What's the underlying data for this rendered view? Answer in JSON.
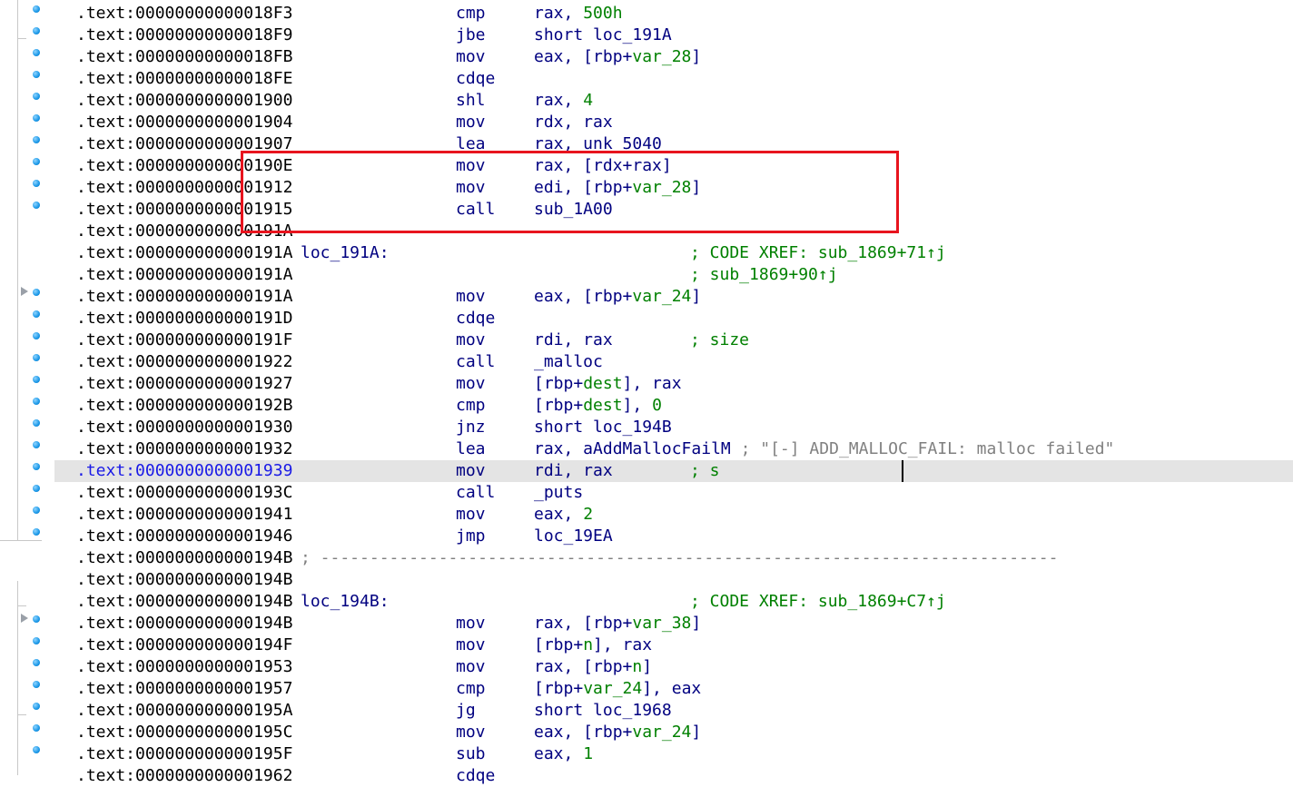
{
  "lines": [
    {
      "addr": ".text:00000000000018F3",
      "label": "",
      "mnem": "cmp",
      "ops": [
        {
          "t": "rax, "
        },
        {
          "t": "500h",
          "c": "num"
        }
      ],
      "cmt": ""
    },
    {
      "addr": ".text:00000000000018F9",
      "label": "",
      "mnem": "jbe",
      "ops": [
        {
          "t": "short loc_191A"
        }
      ],
      "cmt": ""
    },
    {
      "addr": ".text:00000000000018FB",
      "label": "",
      "mnem": "mov",
      "ops": [
        {
          "t": "eax, [rbp+"
        },
        {
          "t": "var_28",
          "c": "var"
        },
        {
          "t": "]"
        }
      ],
      "cmt": ""
    },
    {
      "addr": ".text:00000000000018FE",
      "label": "",
      "mnem": "cdqe",
      "ops": [],
      "cmt": ""
    },
    {
      "addr": ".text:0000000000001900",
      "label": "",
      "mnem": "shl",
      "ops": [
        {
          "t": "rax, "
        },
        {
          "t": "4",
          "c": "num"
        }
      ],
      "cmt": ""
    },
    {
      "addr": ".text:0000000000001904",
      "label": "",
      "mnem": "mov",
      "ops": [
        {
          "t": "rdx, rax"
        }
      ],
      "cmt": ""
    },
    {
      "addr": ".text:0000000000001907",
      "label": "",
      "mnem": "lea",
      "ops": [
        {
          "t": "rax, unk_5040"
        }
      ],
      "cmt": ""
    },
    {
      "addr": ".text:000000000000190E",
      "label": "",
      "mnem": "mov",
      "ops": [
        {
          "t": "rax, [rdx+rax]"
        }
      ],
      "cmt": ""
    },
    {
      "addr": ".text:0000000000001912",
      "label": "",
      "mnem": "mov",
      "ops": [
        {
          "t": "edi, [rbp+"
        },
        {
          "t": "var_28",
          "c": "var"
        },
        {
          "t": "]"
        }
      ],
      "cmt": ""
    },
    {
      "addr": ".text:0000000000001915",
      "label": "",
      "mnem": "call",
      "ops": [
        {
          "t": "sub_1A00"
        }
      ],
      "cmt": ""
    },
    {
      "addr": ".text:000000000000191A",
      "label": "",
      "mnem": "",
      "ops": [],
      "cmt": ""
    },
    {
      "addr": ".text:000000000000191A",
      "label": "loc_191A:",
      "mnem": "",
      "ops": [],
      "cmt": "; CODE XREF: sub_1869+71↑j"
    },
    {
      "addr": ".text:000000000000191A",
      "label": "",
      "mnem": "",
      "ops": [],
      "cmt": "; sub_1869+90↑j"
    },
    {
      "addr": ".text:000000000000191A",
      "label": "",
      "mnem": "mov",
      "ops": [
        {
          "t": "eax, [rbp+"
        },
        {
          "t": "var_24",
          "c": "var"
        },
        {
          "t": "]"
        }
      ],
      "cmt": ""
    },
    {
      "addr": ".text:000000000000191D",
      "label": "",
      "mnem": "cdqe",
      "ops": [],
      "cmt": ""
    },
    {
      "addr": ".text:000000000000191F",
      "label": "",
      "mnem": "mov",
      "ops": [
        {
          "t": "rdi, rax"
        }
      ],
      "cmt": "; size"
    },
    {
      "addr": ".text:0000000000001922",
      "label": "",
      "mnem": "call",
      "ops": [
        {
          "t": "_malloc"
        }
      ],
      "cmt": ""
    },
    {
      "addr": ".text:0000000000001927",
      "label": "",
      "mnem": "mov",
      "ops": [
        {
          "t": "[rbp+"
        },
        {
          "t": "dest",
          "c": "var"
        },
        {
          "t": "], rax"
        }
      ],
      "cmt": ""
    },
    {
      "addr": ".text:000000000000192B",
      "label": "",
      "mnem": "cmp",
      "ops": [
        {
          "t": "[rbp+"
        },
        {
          "t": "dest",
          "c": "var"
        },
        {
          "t": "], "
        },
        {
          "t": "0",
          "c": "num"
        }
      ],
      "cmt": ""
    },
    {
      "addr": ".text:0000000000001930",
      "label": "",
      "mnem": "jnz",
      "ops": [
        {
          "t": "short loc_194B"
        }
      ],
      "cmt": ""
    },
    {
      "addr": ".text:0000000000001932",
      "label": "",
      "mnem": "lea",
      "ops": [
        {
          "t": "rax, aAddMallocFailM "
        },
        {
          "t": "; \"[-] ADD_MALLOC_FAIL: malloc failed\"",
          "c": "str"
        }
      ],
      "cmt": ""
    },
    {
      "addr": ".text:0000000000001939",
      "label": "",
      "mnem": "mov",
      "ops": [
        {
          "t": "rdi, rax"
        }
      ],
      "cmt": "; s",
      "current": true
    },
    {
      "addr": ".text:000000000000193C",
      "label": "",
      "mnem": "call",
      "ops": [
        {
          "t": "_puts"
        }
      ],
      "cmt": ""
    },
    {
      "addr": ".text:0000000000001941",
      "label": "",
      "mnem": "mov",
      "ops": [
        {
          "t": "eax, "
        },
        {
          "t": "2",
          "c": "num"
        }
      ],
      "cmt": ""
    },
    {
      "addr": ".text:0000000000001946",
      "label": "",
      "mnem": "jmp",
      "ops": [
        {
          "t": "loc_19EA"
        }
      ],
      "cmt": ""
    },
    {
      "addr": ".text:000000000000194B",
      "label": "",
      "mnem": "",
      "ops": [],
      "cmt": "",
      "sep": "; ---------------------------------------------------------------------------"
    },
    {
      "addr": ".text:000000000000194B",
      "label": "",
      "mnem": "",
      "ops": [],
      "cmt": ""
    },
    {
      "addr": ".text:000000000000194B",
      "label": "loc_194B:",
      "mnem": "",
      "ops": [],
      "cmt": "; CODE XREF: sub_1869+C7↑j"
    },
    {
      "addr": ".text:000000000000194B",
      "label": "",
      "mnem": "mov",
      "ops": [
        {
          "t": "rax, [rbp+"
        },
        {
          "t": "var_38",
          "c": "var"
        },
        {
          "t": "]"
        }
      ],
      "cmt": ""
    },
    {
      "addr": ".text:000000000000194F",
      "label": "",
      "mnem": "mov",
      "ops": [
        {
          "t": "[rbp+"
        },
        {
          "t": "n",
          "c": "var"
        },
        {
          "t": "], rax"
        }
      ],
      "cmt": ""
    },
    {
      "addr": ".text:0000000000001953",
      "label": "",
      "mnem": "mov",
      "ops": [
        {
          "t": "rax, [rbp+"
        },
        {
          "t": "n",
          "c": "var"
        },
        {
          "t": "]"
        }
      ],
      "cmt": ""
    },
    {
      "addr": ".text:0000000000001957",
      "label": "",
      "mnem": "cmp",
      "ops": [
        {
          "t": "[rbp+"
        },
        {
          "t": "var_24",
          "c": "var"
        },
        {
          "t": "], eax"
        }
      ],
      "cmt": ""
    },
    {
      "addr": ".text:000000000000195A",
      "label": "",
      "mnem": "jg",
      "ops": [
        {
          "t": "short loc_1968"
        }
      ],
      "cmt": ""
    },
    {
      "addr": ".text:000000000000195C",
      "label": "",
      "mnem": "mov",
      "ops": [
        {
          "t": "eax, [rbp+"
        },
        {
          "t": "var_24",
          "c": "var"
        },
        {
          "t": "]"
        }
      ],
      "cmt": ""
    },
    {
      "addr": ".text:000000000000195F",
      "label": "",
      "mnem": "sub",
      "ops": [
        {
          "t": "eax, "
        },
        {
          "t": "1",
          "c": "num"
        }
      ],
      "cmt": ""
    },
    {
      "addr": ".text:0000000000001962",
      "label": "",
      "mnem": "cdqe",
      "ops": [],
      "cmt": ""
    }
  ],
  "gutter": {
    "arrow_color": "#9aa0a8",
    "dot_color": "#1a98e8"
  },
  "highlight": {
    "color": "#e8141e"
  }
}
